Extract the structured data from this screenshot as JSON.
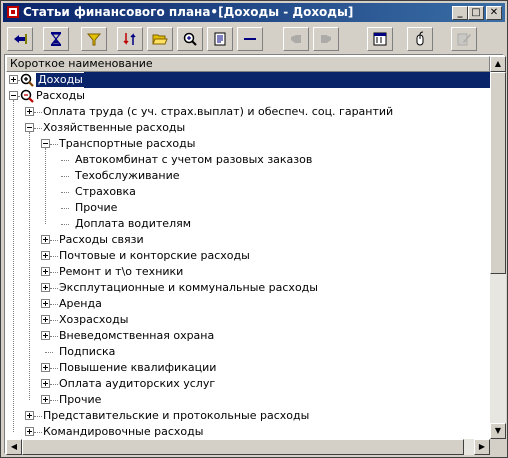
{
  "window": {
    "title": "Статьи финансового плана•[Доходы - Доходы]",
    "controls": {
      "minimize": "_",
      "maximize": "□",
      "close": "✕"
    }
  },
  "toolbar": {
    "buttons": [
      {
        "name": "exit-icon",
        "enabled": true
      },
      {
        "name": "hourglass-icon",
        "enabled": true
      },
      {
        "name": "filter-icon",
        "enabled": true
      },
      {
        "name": "sort-icon",
        "enabled": true
      },
      {
        "name": "open-folder-icon",
        "enabled": true
      },
      {
        "name": "zoom-icon",
        "enabled": true
      },
      {
        "name": "report-icon",
        "enabled": true
      },
      {
        "name": "minus-icon",
        "enabled": true
      },
      {
        "name": "hand-left-icon",
        "enabled": false
      },
      {
        "name": "hand-right-icon",
        "enabled": false
      },
      {
        "name": "calculator-icon",
        "enabled": true
      },
      {
        "name": "mouse-icon",
        "enabled": true
      },
      {
        "name": "edit-icon",
        "enabled": false
      }
    ]
  },
  "table": {
    "column_header": "Короткое наименование",
    "rows": [
      {
        "label": "Доходы",
        "level": 0,
        "expander": "plus",
        "selected": true,
        "icon": "zoom-in-icon"
      },
      {
        "label": "Расходы",
        "level": 0,
        "expander": "minus",
        "selected": false,
        "icon": "zoom-out-icon"
      },
      {
        "label": "Оплата труда (с уч. страх.выплат) и обеспеч. соц. гарантий",
        "level": 1,
        "expander": "plus"
      },
      {
        "label": "Хозяйственные расходы",
        "level": 1,
        "expander": "minus"
      },
      {
        "label": "Транспортные расходы",
        "level": 2,
        "expander": "minus"
      },
      {
        "label": "Автокомбинат с учетом  разовых заказов",
        "level": 3,
        "expander": "none"
      },
      {
        "label": "Техобслуживание",
        "level": 3,
        "expander": "none"
      },
      {
        "label": "Страховка",
        "level": 3,
        "expander": "none"
      },
      {
        "label": "Прочие",
        "level": 3,
        "expander": "none"
      },
      {
        "label": "Доплата водителям",
        "level": 3,
        "expander": "none"
      },
      {
        "label": "Расходы связи",
        "level": 2,
        "expander": "plus"
      },
      {
        "label": "Почтовые и конторские расходы",
        "level": 2,
        "expander": "plus"
      },
      {
        "label": "Ремонт и т\\о техники",
        "level": 2,
        "expander": "plus"
      },
      {
        "label": "Эксплутационные и коммунальные расходы",
        "level": 2,
        "expander": "plus"
      },
      {
        "label": "Аренда",
        "level": 2,
        "expander": "plus"
      },
      {
        "label": "Хозрасходы",
        "level": 2,
        "expander": "plus"
      },
      {
        "label": "Вневедомственная охрана",
        "level": 2,
        "expander": "plus"
      },
      {
        "label": "Подписка",
        "level": 2,
        "expander": "none"
      },
      {
        "label": "Повышение квалификации",
        "level": 2,
        "expander": "plus"
      },
      {
        "label": "Оплата аудиторских услуг",
        "level": 2,
        "expander": "plus"
      },
      {
        "label": "Прочие",
        "level": 2,
        "expander": "plus"
      },
      {
        "label": "Представительские и протокольные расходы",
        "level": 1,
        "expander": "plus"
      },
      {
        "label": "Командировочные расходы",
        "level": 1,
        "expander": "plus"
      }
    ]
  },
  "scrollbars": {
    "up": "▲",
    "down": "▼",
    "left": "◀",
    "right": "▶"
  },
  "colors": {
    "selection": "#0a246a",
    "title_start": "#0a246a",
    "title_end": "#3a6ea5",
    "face": "#d4d0c8"
  }
}
